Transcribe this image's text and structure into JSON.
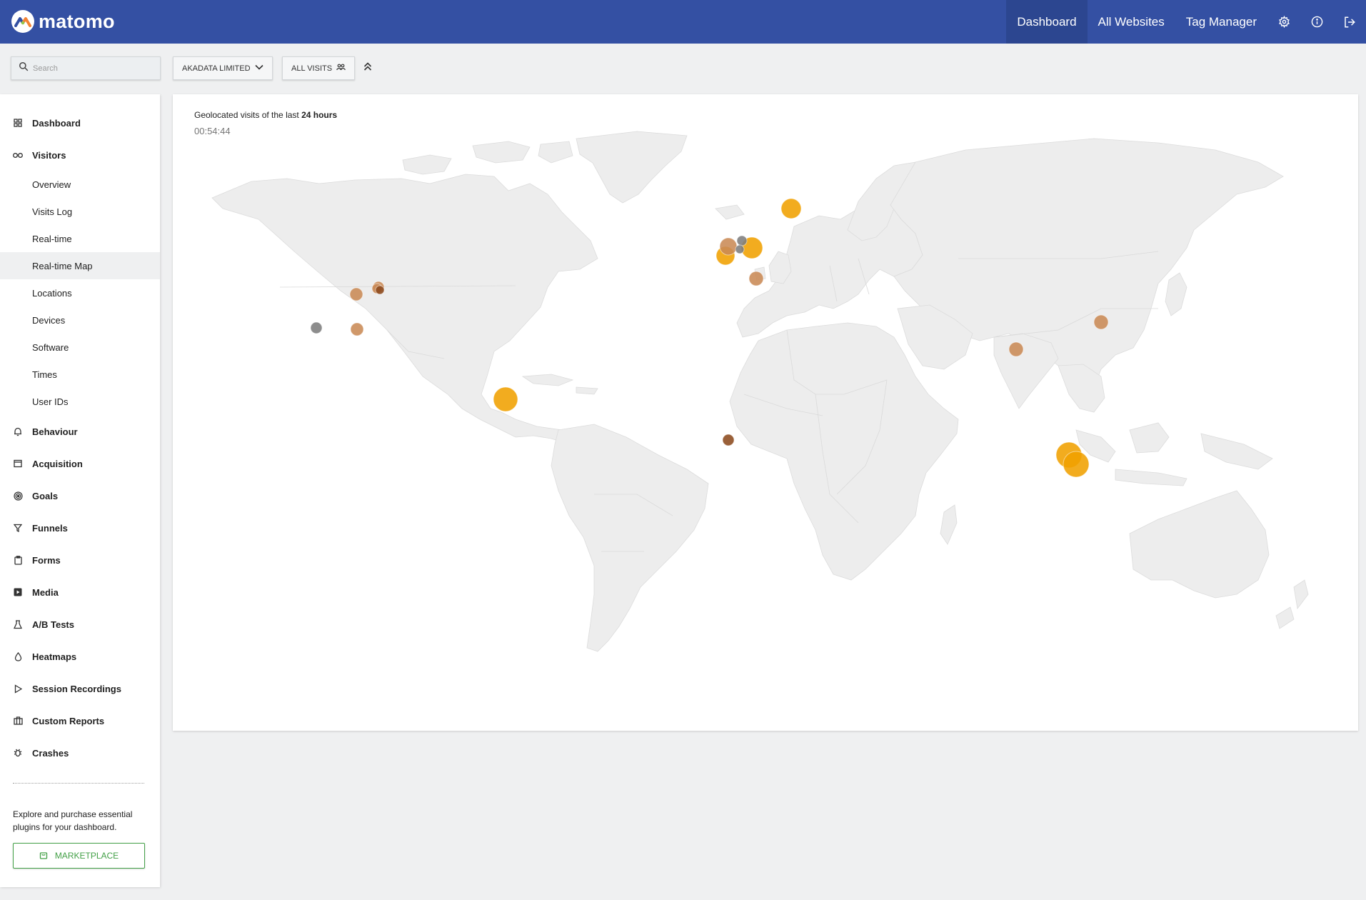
{
  "header": {
    "brand": "matomo",
    "nav": [
      {
        "label": "Dashboard",
        "active": true
      },
      {
        "label": "All Websites",
        "active": false
      },
      {
        "label": "Tag Manager",
        "active": false
      }
    ],
    "icons": [
      "gear-icon",
      "info-icon",
      "logout-icon"
    ]
  },
  "toolbar": {
    "search_placeholder": "Search",
    "site_label": "AKADATA LIMITED",
    "segment_label": "ALL VISITS"
  },
  "sidebar": {
    "groups": [
      {
        "label": "Dashboard",
        "icon": "grid-icon"
      },
      {
        "label": "Visitors",
        "icon": "binoculars-icon"
      },
      {
        "label": "Behaviour",
        "icon": "bell-icon"
      },
      {
        "label": "Acquisition",
        "icon": "window-icon"
      },
      {
        "label": "Goals",
        "icon": "target-icon"
      },
      {
        "label": "Funnels",
        "icon": "funnel-icon"
      },
      {
        "label": "Forms",
        "icon": "clipboard-icon"
      },
      {
        "label": "Media",
        "icon": "media-icon"
      },
      {
        "label": "A/B Tests",
        "icon": "flask-icon"
      },
      {
        "label": "Heatmaps",
        "icon": "drop-icon"
      },
      {
        "label": "Session Recordings",
        "icon": "play-icon"
      },
      {
        "label": "Custom Reports",
        "icon": "briefcase-icon"
      },
      {
        "label": "Crashes",
        "icon": "bug-icon"
      }
    ],
    "visitor_items": [
      {
        "label": "Overview",
        "active": false
      },
      {
        "label": "Visits Log",
        "active": false
      },
      {
        "label": "Real-time",
        "active": false
      },
      {
        "label": "Real-time Map",
        "active": true
      },
      {
        "label": "Locations",
        "active": false
      },
      {
        "label": "Devices",
        "active": false
      },
      {
        "label": "Software",
        "active": false
      },
      {
        "label": "Times",
        "active": false
      },
      {
        "label": "User IDs",
        "active": false
      }
    ],
    "promo_text": "Explore and purchase essential plugins for your dashboard.",
    "marketplace_label": "MARKETPLACE"
  },
  "map": {
    "caption_prefix": "Geolocated visits of the last ",
    "caption_bold": "24 hours",
    "time": "00:54:44",
    "colors": {
      "recent": "#f0a000",
      "older": "#c98a55",
      "oldest": "#8c4a1e",
      "inactive": "#7d7d7d"
    }
  }
}
